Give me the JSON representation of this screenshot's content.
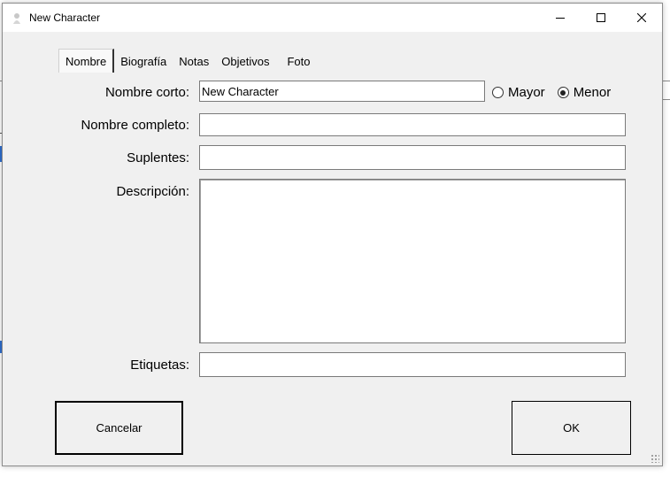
{
  "window": {
    "title": "New Character"
  },
  "tabs": [
    {
      "label": "Nombre",
      "active": true
    },
    {
      "label": "Biografía",
      "active": false
    },
    {
      "label": "Notas",
      "active": false
    },
    {
      "label": "Objetivos",
      "active": false
    },
    {
      "label": "Foto",
      "active": false
    }
  ],
  "form": {
    "short_name_label": "Nombre corto:",
    "short_name_value": "New Character",
    "full_name_label": "Nombre completo:",
    "full_name_value": "",
    "alternates_label": "Suplentes:",
    "alternates_value": "",
    "description_label": "Descripción:",
    "description_value": "",
    "tags_label": "Etiquetas:",
    "tags_value": "",
    "age_options": [
      {
        "label": "Mayor",
        "checked": false
      },
      {
        "label": "Menor",
        "checked": true
      }
    ]
  },
  "buttons": {
    "cancel_label": "Cancelar",
    "ok_label": "OK"
  }
}
